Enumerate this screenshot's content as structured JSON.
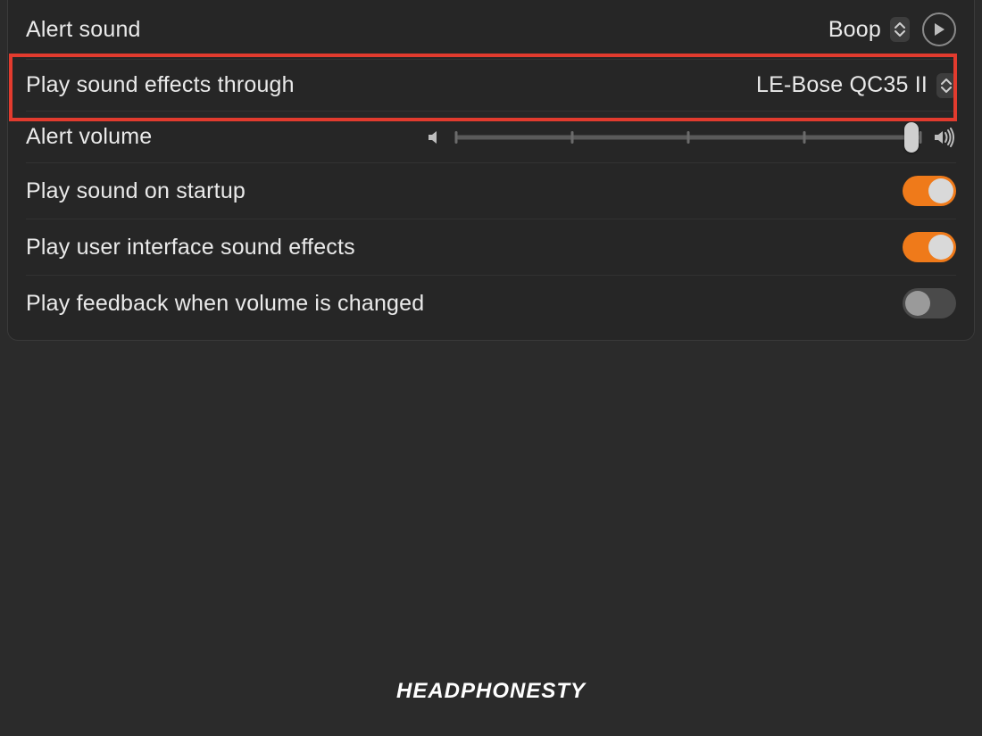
{
  "rows": {
    "alert_sound": {
      "label": "Alert sound",
      "value": "Boop"
    },
    "play_through": {
      "label": "Play sound effects through",
      "value": "LE-Bose QC35 II"
    },
    "alert_volume": {
      "label": "Alert volume",
      "value_percent": 98
    },
    "startup": {
      "label": "Play sound on startup",
      "on": true
    },
    "ui_effects": {
      "label": "Play user interface sound effects",
      "on": true
    },
    "feedback": {
      "label": "Play feedback when volume is changed",
      "on": false
    }
  },
  "watermark": "HEADPHONESTY",
  "colors": {
    "accent": "#ef7a1a",
    "highlight": "#e23b2e"
  }
}
